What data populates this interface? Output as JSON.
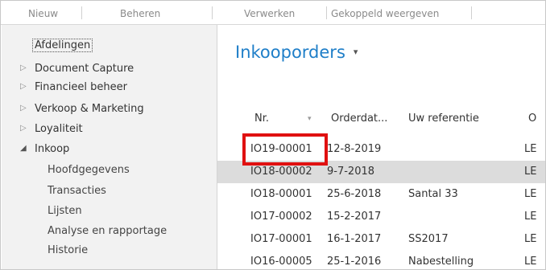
{
  "ribbon": {
    "items": [
      "Nieuw",
      "Beheren",
      "Verwerken",
      "Gekoppeld weergeven"
    ]
  },
  "nav": {
    "items": [
      {
        "label": "Afdelingen"
      },
      {
        "label": "Document Capture",
        "arrow": "▷"
      },
      {
        "label": "Financieel beheer",
        "arrow": "▷"
      },
      {
        "label": "Verkoop & Marketing",
        "arrow": "▷"
      },
      {
        "label": "Loyaliteit",
        "arrow": "▷"
      },
      {
        "label": "Inkoop",
        "arrow": "◢"
      },
      {
        "label": "Hoofdgegevens"
      },
      {
        "label": "Transacties"
      },
      {
        "label": "Lijsten"
      },
      {
        "label": "Analyse en rapportage"
      },
      {
        "label": "Historie"
      }
    ]
  },
  "main": {
    "title": "Inkooporders",
    "title_dropdown": "▾",
    "columns": [
      "Nr.",
      "Orderdat...",
      "Uw referentie",
      "O"
    ],
    "sort_indicator": "▾",
    "rows": [
      {
        "nr": "IO19-00001",
        "date": "12-8-2019",
        "ref": "",
        "o": "LE"
      },
      {
        "nr": "IO18-00002",
        "date": "9-7-2018",
        "ref": "",
        "o": "LE"
      },
      {
        "nr": "IO18-00001",
        "date": "25-6-2018",
        "ref": "Santal 33",
        "o": "LE"
      },
      {
        "nr": "IO17-00002",
        "date": "15-2-2017",
        "ref": "",
        "o": "LE"
      },
      {
        "nr": "IO17-00001",
        "date": "16-1-2017",
        "ref": "SS2017",
        "o": "LE"
      },
      {
        "nr": "IO16-00005",
        "date": "25-1-2016",
        "ref": "Nabestelling",
        "o": "LE"
      }
    ]
  },
  "colors": {
    "accent": "#1e7ec8",
    "highlight": "#e01010",
    "selected_row": "#dcdcdc",
    "nav_background": "#f2f2f2"
  }
}
